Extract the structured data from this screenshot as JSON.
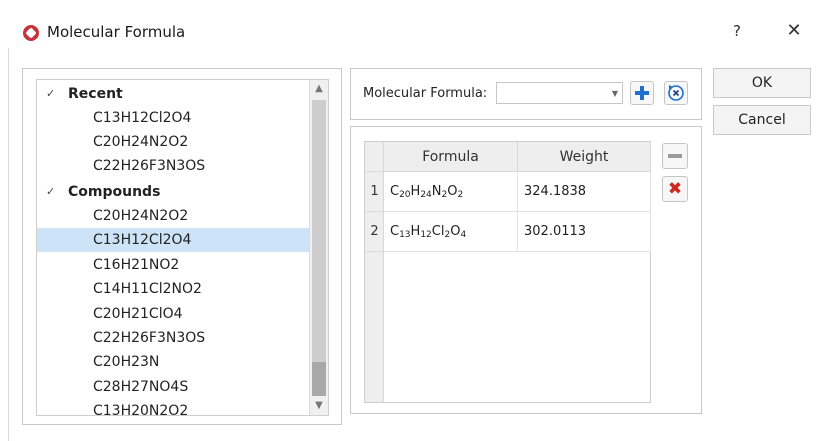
{
  "window": {
    "title": "Molecular Formula",
    "help_label": "?",
    "close_label": "✕"
  },
  "tree": {
    "sections": [
      {
        "label": "Recent",
        "items": [
          "C13H12Cl2O4",
          "C20H24N2O2",
          "C22H26F3N3OS"
        ]
      },
      {
        "label": "Compounds",
        "items": [
          "C20H24N2O2",
          "C13H12Cl2O4",
          "C16H21NO2",
          "C14H11Cl2NO2",
          "C20H21ClO4",
          "C22H26F3N3OS",
          "C20H23N",
          "C28H27NO4S",
          "C13H20N2O2"
        ]
      }
    ],
    "selected": "C13H12Cl2O4",
    "scroll_up_glyph": "▲",
    "scroll_down_glyph": "▼"
  },
  "formula_input": {
    "label": "Molecular Formula:",
    "value": "",
    "dropdown_glyph": "▼"
  },
  "results": {
    "columns": [
      "Formula",
      "Weight"
    ],
    "rows": [
      {
        "index": "1",
        "formula": "C20H24N2O2",
        "weight": "324.1838"
      },
      {
        "index": "2",
        "formula": "C13H12Cl2O4",
        "weight": "302.0113"
      }
    ]
  },
  "buttons": {
    "ok": "OK",
    "cancel": "Cancel",
    "remove_glyph": "✖"
  },
  "colors": {
    "accent_blue": "#1e6fd0",
    "delete_red": "#d0281f",
    "selection": "#cde3f7",
    "app_icon": "#c8323a"
  }
}
